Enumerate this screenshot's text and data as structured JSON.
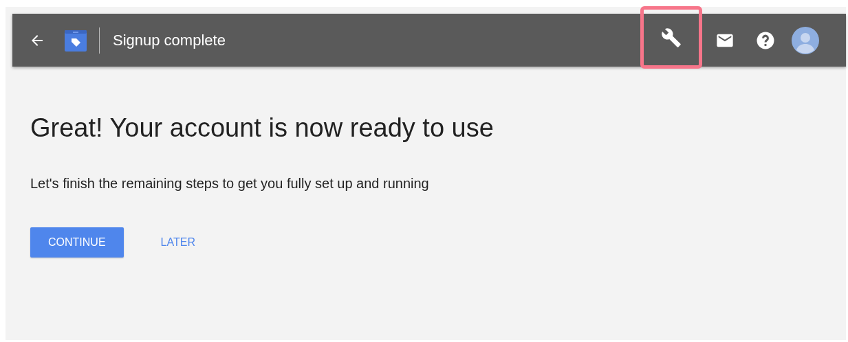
{
  "header": {
    "title": "Signup complete",
    "actions": [
      {
        "kind": "wrench",
        "highlighted": true
      },
      {
        "kind": "mail",
        "highlighted": false
      },
      {
        "kind": "help",
        "highlighted": false
      },
      {
        "kind": "avatar",
        "highlighted": false
      }
    ]
  },
  "heading": "Great! Your account is now ready to use",
  "message": "Let's finish the remaining steps to get you fully set up and running",
  "buttons": [
    {
      "label": "CONTINUE",
      "kind": "primary"
    },
    {
      "label": "LATER",
      "kind": "text"
    }
  ]
}
